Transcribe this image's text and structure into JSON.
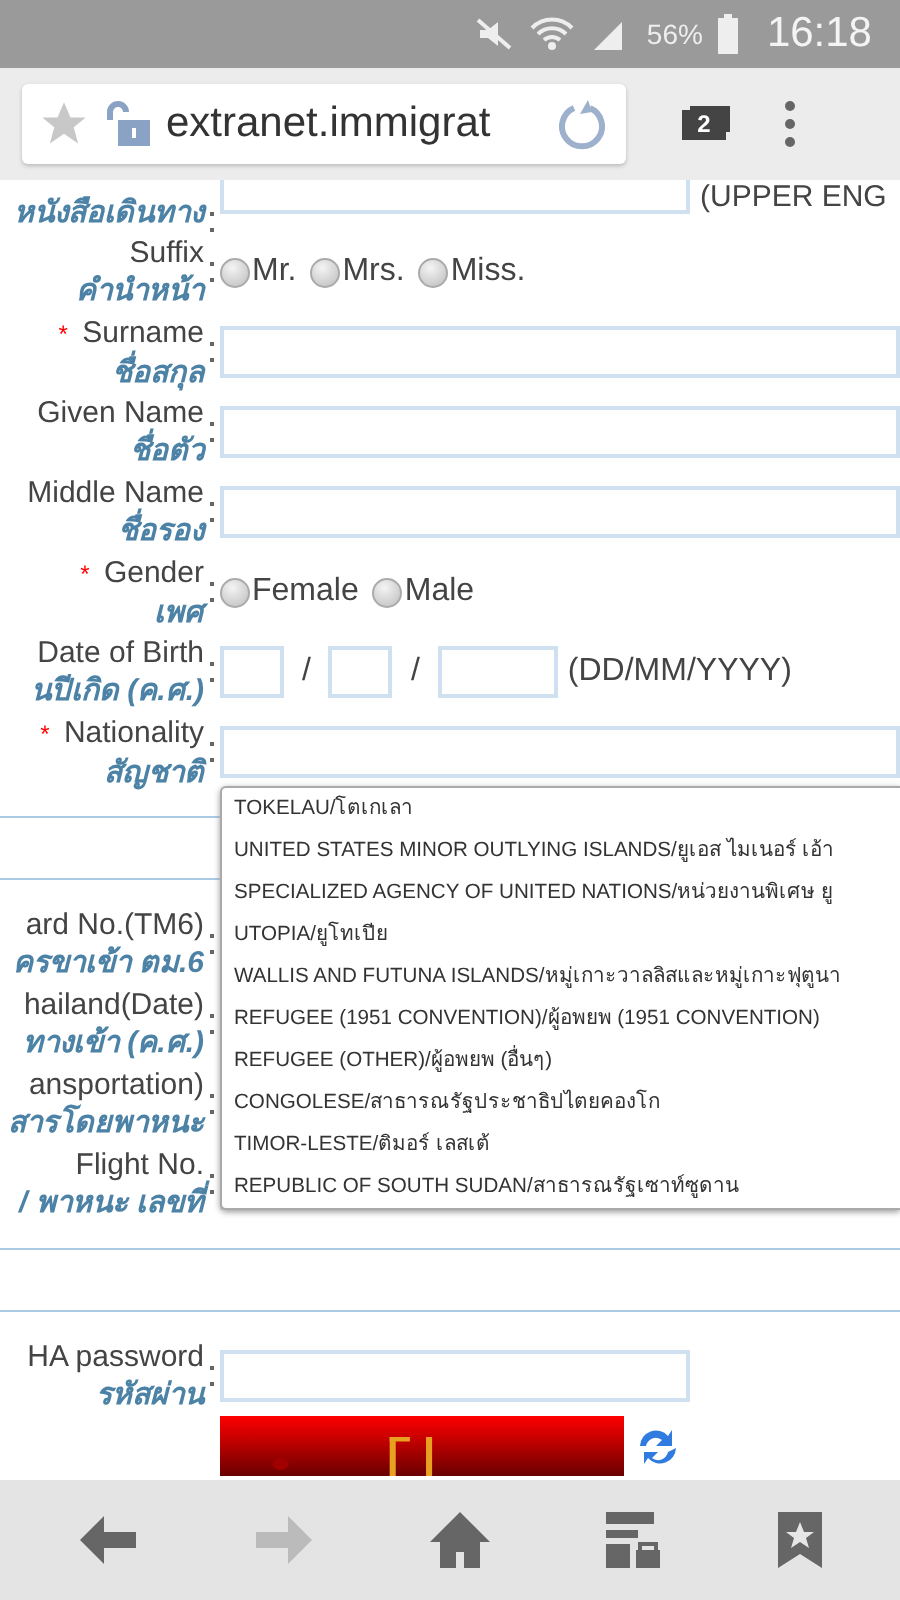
{
  "status_bar": {
    "battery": "56%",
    "time": "16:18"
  },
  "browser": {
    "url": "extranet.immigrat",
    "tab_count": "2"
  },
  "form": {
    "sections": [
      {
        "rows": [
          {
            "kind": "short_text",
            "label": "",
            "thai": "หนังสือเดินทาง",
            "hint": "(UPPER ENG"
          },
          {
            "kind": "radio",
            "label": "Suffix",
            "thai": "คำนำหน้า",
            "options": [
              {
                "label": "Mr.",
                "selected": false
              },
              {
                "label": "Mrs.",
                "selected": false
              },
              {
                "label": "Miss.",
                "selected": false
              }
            ]
          },
          {
            "kind": "text",
            "label": "Surname",
            "thai": "ชื่อสกุล",
            "required": "*"
          },
          {
            "kind": "text",
            "label": "Given Name",
            "thai": "ชื่อตัว"
          },
          {
            "kind": "text",
            "label": "Middle Name",
            "thai": "ชื่อรอง"
          },
          {
            "kind": "radio",
            "label": "Gender",
            "thai": "เพศ",
            "required": "*",
            "options": [
              {
                "label": "Female",
                "selected": false
              },
              {
                "label": "Male",
                "selected": false
              }
            ]
          },
          {
            "kind": "date",
            "label": "Date of Birth",
            "thai": "นปีเกิด (ค.ศ.)",
            "separator": "/",
            "hint": "(DD/MM/YYYY)"
          },
          {
            "kind": "text",
            "label": "Nationality",
            "thai": "สัญชาติ",
            "required": "*"
          }
        ]
      },
      {
        "rows": [
          {
            "kind": "covered",
            "label": "ard No.(TM6)",
            "thai": "ครขาเข้า ตม.6"
          },
          {
            "kind": "covered",
            "label": "hailand(Date)",
            "thai": "ทางเข้า (ค.ศ.)"
          },
          {
            "kind": "covered",
            "label": "ansportation)",
            "thai": "สารโดยพาหนะ"
          },
          {
            "kind": "short_text",
            "label": "Flight No.",
            "thai": "/ พาหนะ เลขที่"
          }
        ]
      },
      {
        "rows": [
          {
            "kind": "short_text",
            "label": "HA password",
            "thai": "รหัสผ่าน"
          },
          {
            "kind": "captcha"
          }
        ]
      }
    ],
    "dropdown": {
      "options": [
        "TOKELAU/โตเกเลา",
        "UNITED STATES MINOR OUTLYING ISLANDS/ยูเอส ไมเนอร์ เอ้า",
        "SPECIALIZED AGENCY OF UNITED NATIONS/หน่วยงานพิเศษ ยู",
        "UTOPIA/ยูโทเปีย",
        "WALLIS AND FUTUNA ISLANDS/หมู่เกาะวาลลิสและหมู่เกาะฟุตูนา",
        "REFUGEE (1951 CONVENTION)/ผู้อพยพ (1951 CONVENTION)",
        "REFUGEE (OTHER)/ผู้อพยพ (อื่นๆ)",
        "CONGOLESE/สาธารณรัฐประชาธิปไตยคองโก",
        "TIMOR-LESTE/ติมอร์ เลสเต้",
        "REPUBLIC OF SOUTH SUDAN/สาธารณรัฐเซาท์ซูดาน"
      ]
    }
  }
}
